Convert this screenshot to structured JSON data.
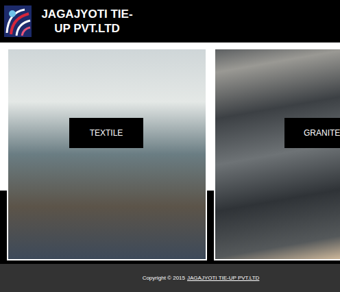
{
  "header": {
    "title": "JAGAJYOTI TIE-UP PVT.LTD"
  },
  "cards": [
    {
      "label": "TEXTILE"
    },
    {
      "label": "GRANITE"
    }
  ],
  "footer": {
    "copyright": "Copyright © 2015",
    "link": "JAGAJYOTI TIE-UP PVT.LTD"
  }
}
